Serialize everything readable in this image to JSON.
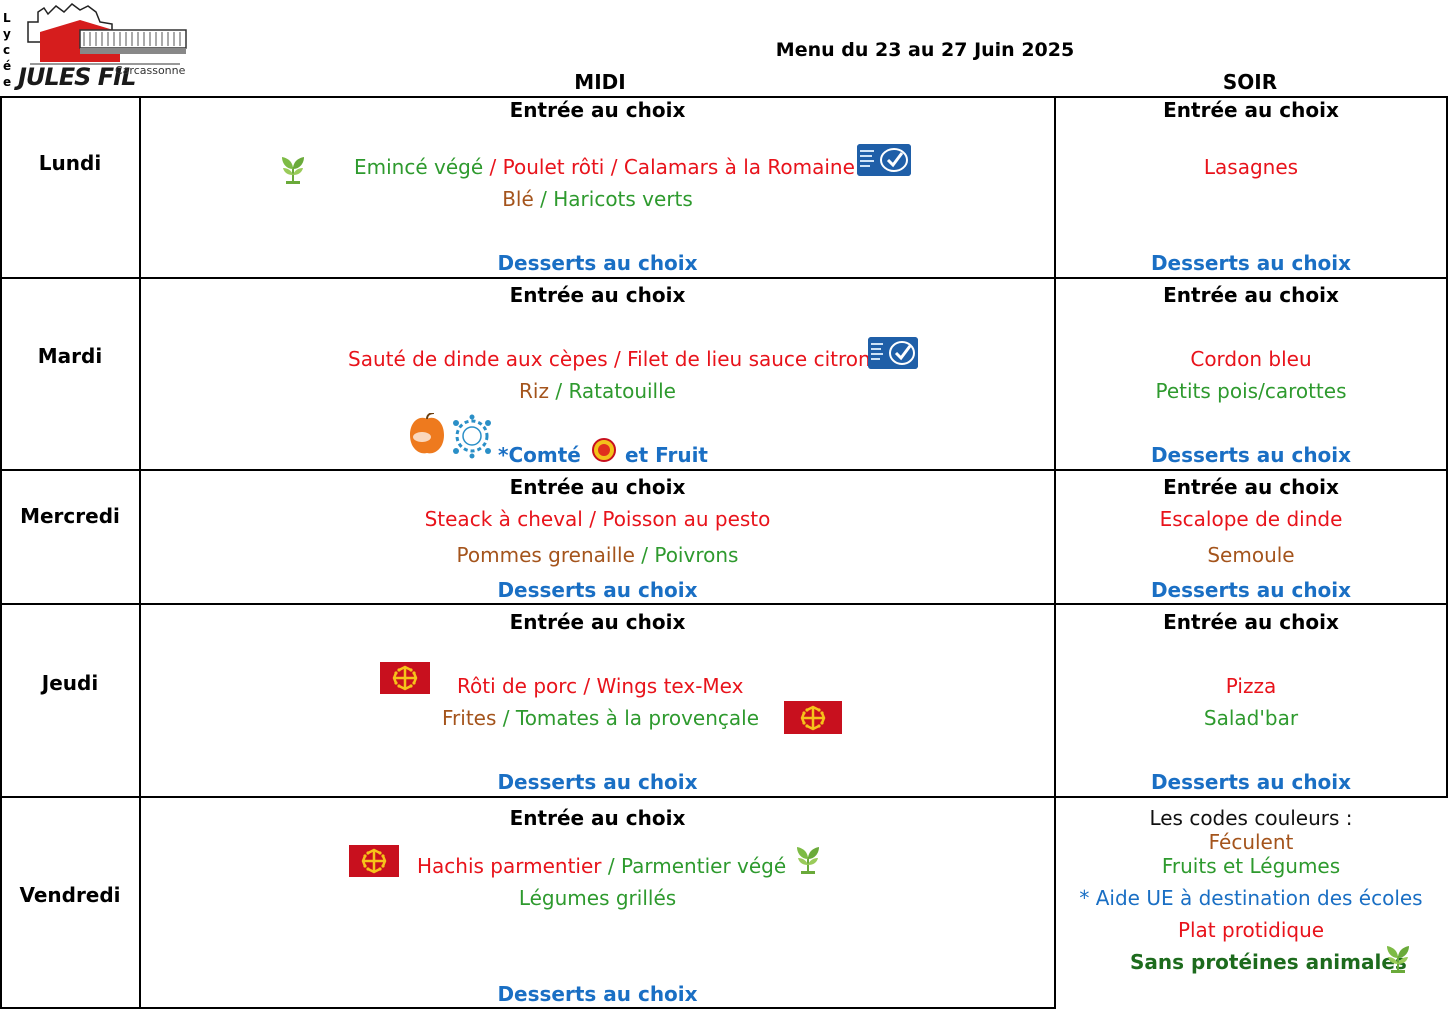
{
  "header": {
    "logo_vertical": [
      "L",
      "y",
      "c",
      "é",
      "e"
    ],
    "logo_name": "JULES FIL",
    "logo_city": "Carcassonne",
    "title": "Menu du 23 au 27 Juin 2025",
    "col_midi": "MIDI",
    "col_soir": "SOIR"
  },
  "common": {
    "entree": "Entrée au choix",
    "desserts": "Desserts au choix",
    "sep": "/"
  },
  "days": {
    "lundi": {
      "name": "Lundi",
      "midi_main": [
        "Emincé végé",
        "Poulet rôti",
        "Calamars à la Romaine"
      ],
      "midi_side": [
        "Blé",
        "Haricots verts"
      ],
      "soir_main": "Lasagnes"
    },
    "mardi": {
      "name": "Mardi",
      "midi_main": [
        "Sauté de dinde aux cèpes",
        "Filet de lieu sauce citron"
      ],
      "midi_side": [
        "Riz",
        "Ratatouille"
      ],
      "midi_dessert_a": "*Comté",
      "midi_dessert_b": "et Fruit",
      "soir_main": "Cordon bleu",
      "soir_side": "Petits pois/carottes"
    },
    "mercredi": {
      "name": "Mercredi",
      "midi_main": [
        "Steack à cheval",
        "Poisson au pesto"
      ],
      "midi_side": [
        "Pommes grenaille",
        "Poivrons"
      ],
      "soir_main": "Escalope de dinde",
      "soir_side": "Semoule"
    },
    "jeudi": {
      "name": "Jeudi",
      "midi_main": [
        "Rôti de porc",
        "Wings tex-Mex"
      ],
      "midi_side": [
        "Frites",
        "Tomates à la provençale"
      ],
      "soir_main": "Pizza",
      "soir_side": "Salad'bar"
    },
    "vendredi": {
      "name": "Vendredi",
      "midi_main": [
        "Hachis parmentier",
        "Parmentier végé"
      ],
      "midi_side": "Légumes grillés"
    }
  },
  "legend": {
    "title": "Les codes couleurs :",
    "feculent": "Féculent",
    "fruits": "Fruits et Légumes",
    "ue": "* Aide UE à destination des écoles",
    "plat": "Plat protidique",
    "sans": "Sans protéines animales"
  },
  "colors": {
    "protein": "#e8131b",
    "starch": "#a4541c",
    "veg": "#2e9a2e",
    "info": "#1a6fc4",
    "vegan": "#1d6b1d"
  },
  "icons": [
    "leaf-icon",
    "msc-label-icon",
    "occitanie-cross-icon",
    "fruit-icon",
    "school-program-icon",
    "aop-seal-icon",
    "school-building-logo"
  ]
}
